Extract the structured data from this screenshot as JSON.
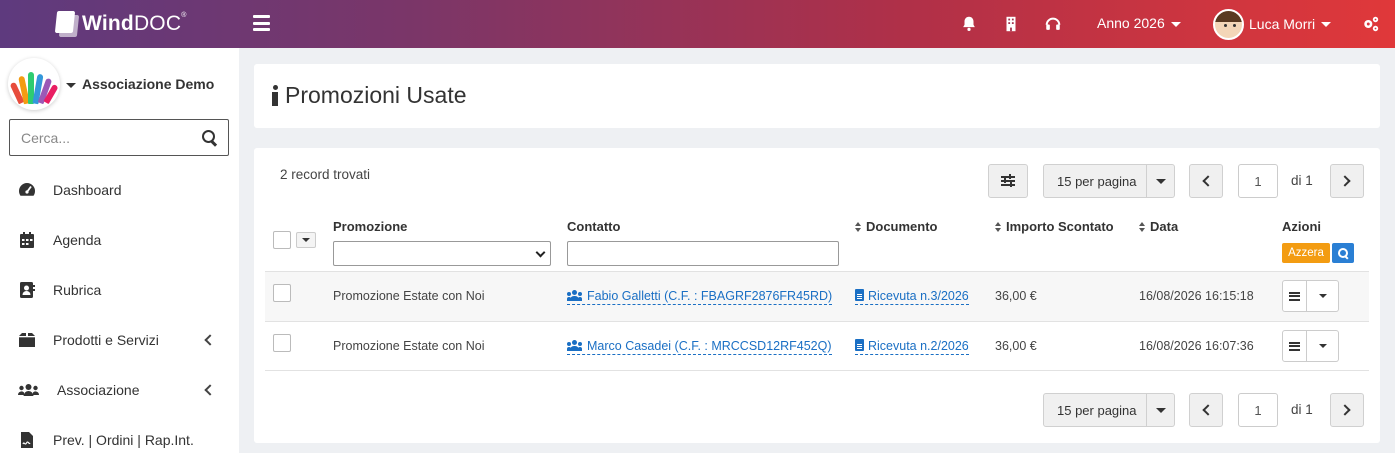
{
  "app": {
    "logo_bold": "Wind",
    "logo_light": "DOC",
    "logo_mark": "®"
  },
  "topbar": {
    "year_label": "Anno 2026",
    "user_name": "Luca Morri",
    "icons": [
      "menu-icon",
      "bell-icon",
      "building-icon",
      "headset-icon",
      "gears-icon"
    ]
  },
  "sidebar": {
    "org_name": "Associazione Demo",
    "search_placeholder": "Cerca...",
    "items": [
      {
        "label": "Dashboard",
        "icon": "tachometer-icon"
      },
      {
        "label": "Agenda",
        "icon": "calendar-icon"
      },
      {
        "label": "Rubrica",
        "icon": "address-book-icon"
      },
      {
        "label": "Prodotti e Servizi",
        "icon": "box-icon",
        "has_submenu": true
      },
      {
        "label": "Associazione",
        "icon": "users-icon",
        "has_submenu": true
      },
      {
        "label": "Prev. | Ordini | Rap.Int.",
        "icon": "file-signature-icon"
      }
    ]
  },
  "page": {
    "title": "Promozioni Usate"
  },
  "list": {
    "records_found": "2 record trovati",
    "per_page": "15 per pagina",
    "current_page": "1",
    "page_of": "di 1",
    "columns": {
      "promozione": "Promozione",
      "contatto": "Contatto",
      "documento": "Documento",
      "importo": "Importo Scontato",
      "data": "Data",
      "azioni": "Azioni"
    },
    "azzera_label": "Azzera",
    "rows": [
      {
        "promozione": "Promozione Estate con Noi",
        "contatto": "Fabio Galletti (C.F. : FBAGRF2876FR45RD)",
        "documento": "Ricevuta n.3/2026",
        "importo": "36,00 €",
        "data": "16/08/2026 16:15:18"
      },
      {
        "promozione": "Promozione Estate con Noi",
        "contatto": "Marco Casadei (C.F. : MRCCSD12RF452Q)",
        "documento": "Ricevuta n.2/2026",
        "importo": "36,00 €",
        "data": "16/08/2026 16:07:36"
      }
    ]
  },
  "colors": {
    "accent_link": "#1a6fc4",
    "azzera": "#f39c12",
    "search_btn": "#2a7fd4",
    "topbar_start": "#5e3a7e",
    "topbar_end": "#e0383a"
  }
}
